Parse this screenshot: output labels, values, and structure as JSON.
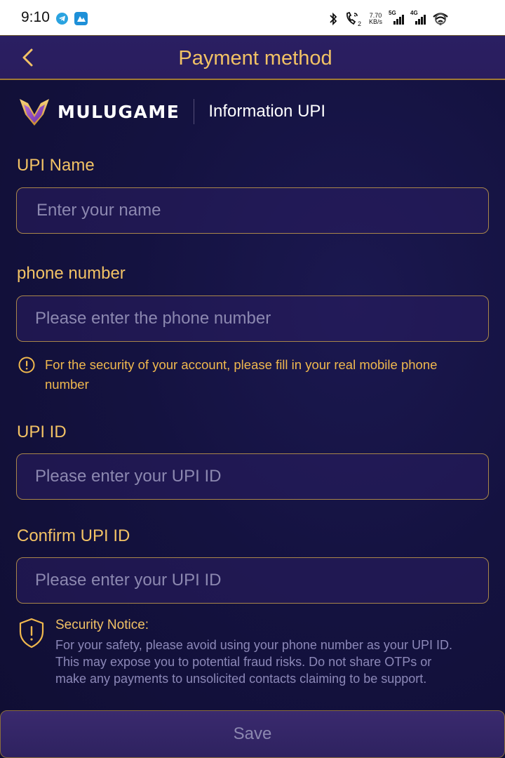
{
  "status_bar": {
    "time": "9:10",
    "net_speed_value": "7.70",
    "net_speed_unit": "KB/s",
    "sim1_label": "5G",
    "sim2_label": "4G",
    "call_sim": "2",
    "icons": [
      "telegram-icon",
      "app-notification-icon",
      "bluetooth-icon",
      "wifi-calling-icon",
      "signal-icon",
      "wifi-icon",
      "battery-icon"
    ]
  },
  "header": {
    "title": "Payment method",
    "back_icon": "chevron-left-icon"
  },
  "brand": {
    "name": "MULUGAME",
    "subtitle": "Information UPI"
  },
  "form": {
    "upi_name": {
      "label": "UPI Name",
      "placeholder": "Enter your name",
      "value": ""
    },
    "phone": {
      "label": "phone number",
      "placeholder": "Please enter the phone number",
      "value": "",
      "hint": "For the security of your account, please fill in your real mobile phone number"
    },
    "upi_id": {
      "label": "UPI ID",
      "placeholder": "Please enter your UPI ID",
      "value": ""
    },
    "confirm_upi_id": {
      "label": "Confirm UPI ID",
      "placeholder": "Please enter your UPI ID",
      "value": ""
    }
  },
  "notice": {
    "title": "Security Notice:",
    "body": "For your safety, please avoid using your phone number as your UPI ID. This may expose you to potential fraud risks. Do not share OTPs or make any payments to unsolicited contacts claiming to be support."
  },
  "save_button": {
    "label": "Save"
  },
  "colors": {
    "accent_gold": "#f2c265",
    "background": "#141240",
    "header_bg": "#2a1f62",
    "placeholder": "#8c88b0"
  }
}
